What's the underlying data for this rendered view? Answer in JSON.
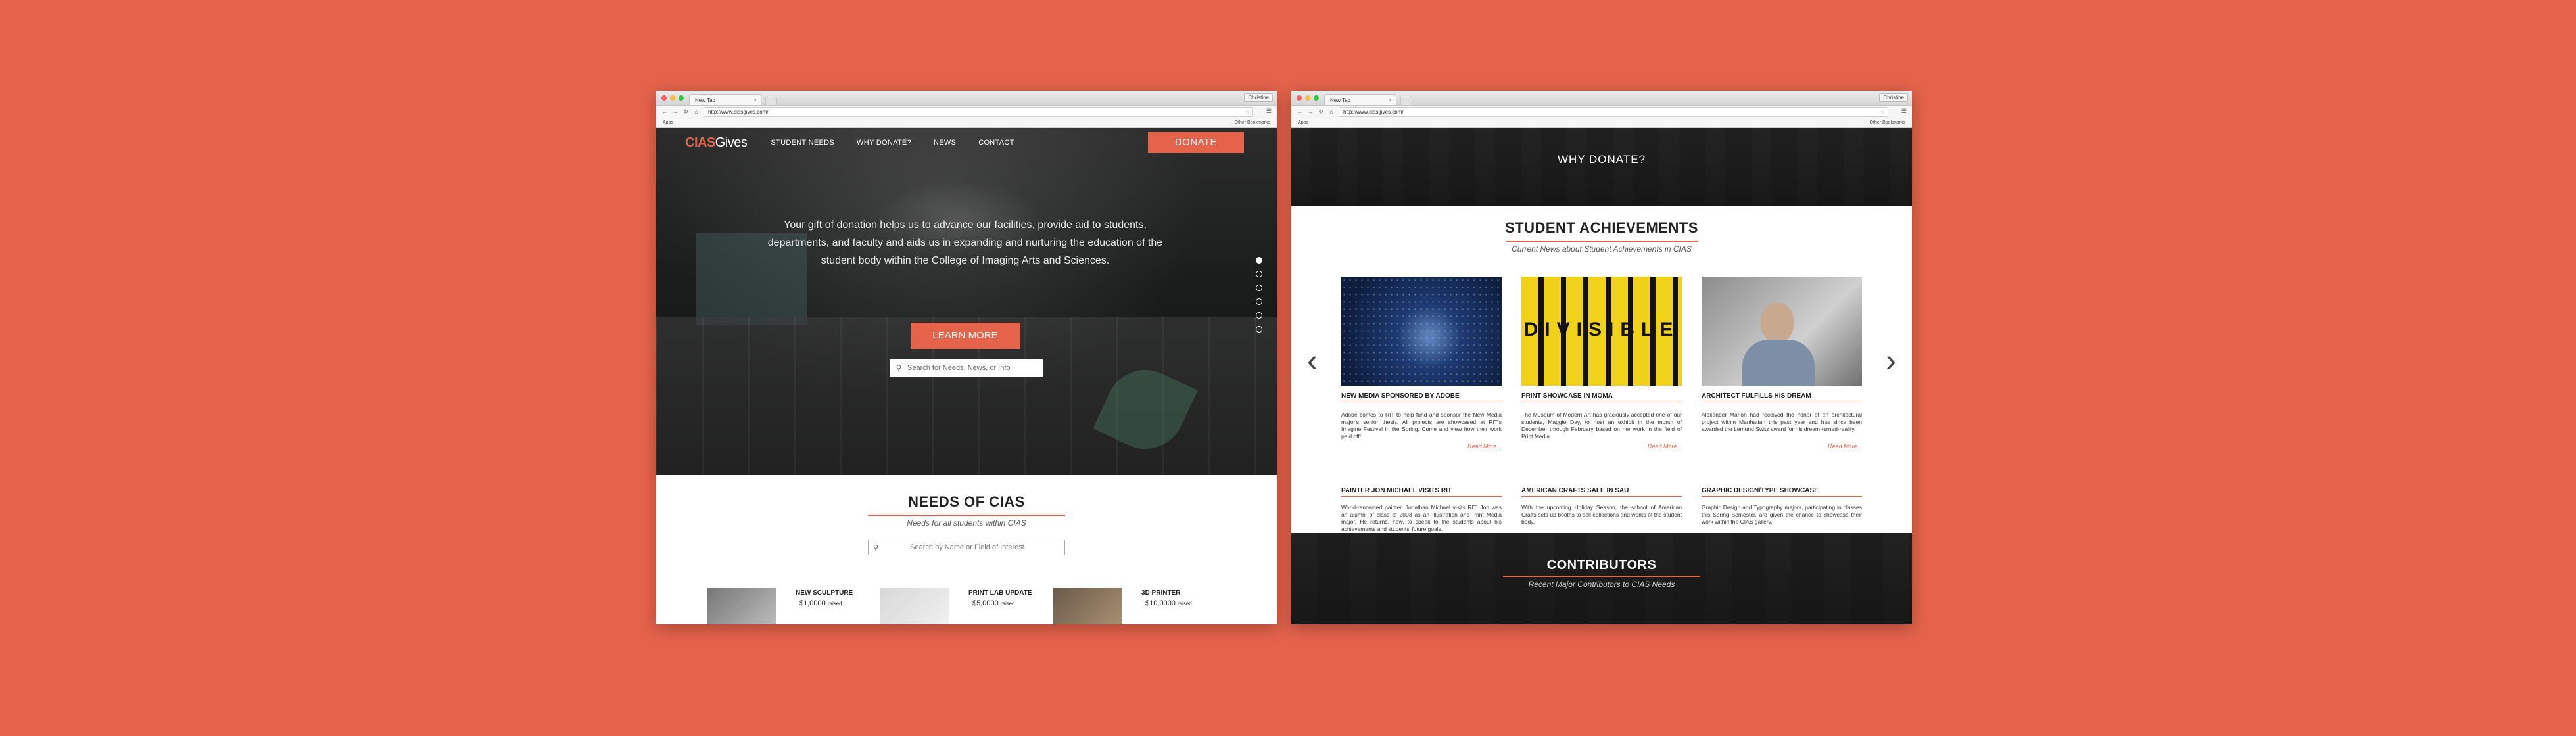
{
  "colors": {
    "background": "#e5634b",
    "accent": "#e5634b"
  },
  "left": {
    "browser": {
      "tab_title": "New Tab",
      "tab_close": "×",
      "profile": "Christine",
      "url": "http://www.ciasgives.com/",
      "bookmarks": "Apps",
      "other_bookmarks": "Other Bookmarks"
    },
    "logo": {
      "part1": "CIAS",
      "part2": "Gives"
    },
    "nav": [
      "STUDENT NEEDS",
      "WHY DONATE?",
      "NEWS",
      "CONTACT"
    ],
    "donate_label": "DONATE",
    "hero_text": "Your gift of donation helps us to advance our facilities, provide aid to students, departments, and faculty and aids us in expanding and nurturing the education of the student body within the College of Imaging Arts and Sciences.",
    "learn_more": "LEARN MORE",
    "hero_search_placeholder": "Search for Needs, News, or Info",
    "slide_count": 6,
    "active_slide": 1,
    "needs": {
      "title": "NEEDS OF CIAS",
      "subtitle": "Needs for all students within CIAS",
      "search_placeholder": "Search by Name or Field of Interest",
      "items": [
        {
          "title": "NEW SCULPTURE",
          "amount": "$1,0000",
          "unit": "raised"
        },
        {
          "title": "PRINT LAB UPDATE",
          "amount": "$5,0000",
          "unit": "raised"
        },
        {
          "title": "3D PRINTER",
          "amount": "$10,0000",
          "unit": "raised"
        }
      ]
    }
  },
  "right": {
    "browser": {
      "tab_title": "New Tab",
      "tab_close": "×",
      "profile": "Christine",
      "url": "http://www.ciasgives.com/",
      "bookmarks": "Apps",
      "other_bookmarks": "Other Bookmarks"
    },
    "why_title": "WHY DONATE?",
    "achievements": {
      "title": "STUDENT ACHIEVEMENTS",
      "subtitle": "Current News about Student Achievements in CIAS",
      "read_more": "Read More...",
      "cards": [
        {
          "title": "NEW MEDIA SPONSORED BY ADOBE",
          "body": "Adobe comes to RIT to help fund and sponsor the New Media major's senior thesis. All projects are showcased at RIT's Imagine Festival in the Spring. Come and view how their work paid off!"
        },
        {
          "title": "PRINT SHOWCASE IN MOMA",
          "body": "The Museum of Modern Art has graciously accepted one of our students, Maggie Day, to host an exhibit in the month of December through February based on her work in the field of Print Media."
        },
        {
          "title": "ARCHITECT FULFILLS HIS DREAM",
          "body": "Alexander Marion had received the honor of an architectural project within Manhattan this past year and has since been awarded the Lemund Switz award for his dream-turned-reality."
        },
        {
          "title": "PAINTER JON MICHAEL VISITS RIT",
          "body": "World-renowned painter, Jonathan Michael visits RIT. Jon was an alumni of class of 2003 as an Illustration and Print Media major. He returns, now, to speak to the students about his achievements and students' future goals."
        },
        {
          "title": "AMERICAN CRAFTS SALE IN SAU",
          "body": "With the upcoming Holiday Season, the school of American Crafts sets up booths to sell collections and works of the student body."
        },
        {
          "title": "GRAPHIC DESIGN/TYPE SHOWCASE",
          "body": "Graphic Design and Typography majors, participating in classes this Spring Semester, are given the chance to showcase their work within the CIAS gallery."
        }
      ],
      "image_text": "DIVISIBLE"
    },
    "contributors": {
      "title": "CONTRIBUTORS",
      "subtitle": "Recent Major Contributors to CIAS Needs"
    }
  }
}
